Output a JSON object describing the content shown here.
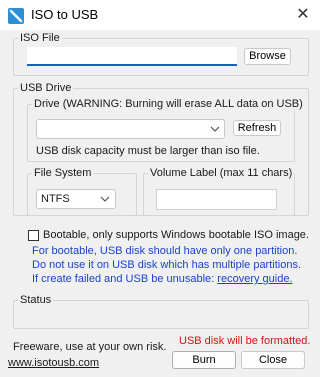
{
  "window": {
    "title": "ISO to USB",
    "close_glyph": "✕"
  },
  "iso_file": {
    "group_label": "ISO File",
    "path_value": "",
    "browse_label": "Browse"
  },
  "usb_drive": {
    "group_label": "USB Drive",
    "drive_label": "Drive (WARNING: Burning will erase ALL data on USB)",
    "drive_value": "",
    "refresh_label": "Refresh",
    "capacity_note": "USB disk capacity must be larger than iso file."
  },
  "file_system": {
    "group_label": "File System",
    "selected": "NTFS"
  },
  "volume_label": {
    "group_label": "Volume Label (max 11 chars)",
    "value": ""
  },
  "bootable": {
    "checkbox_label": "Bootable, only supports Windows bootable ISO image.",
    "checked": false,
    "note_1": "For bootable, USB disk should have only one partition.",
    "note_2": "Do not use it on USB disk which has multiple partitions.",
    "note_3_prefix": "If create failed and USB be unusable: ",
    "recovery_link": "recovery guide.",
    "accent_color": "#1a43c8"
  },
  "status": {
    "group_label": "Status",
    "text": ""
  },
  "footer": {
    "freeware_text": "Freeware, use at your own risk.",
    "warning_text": "USB disk will be formatted.",
    "warning_color": "#d01414",
    "website_link": "www.isotousb.com",
    "burn_label": "Burn",
    "close_label": "Close"
  }
}
